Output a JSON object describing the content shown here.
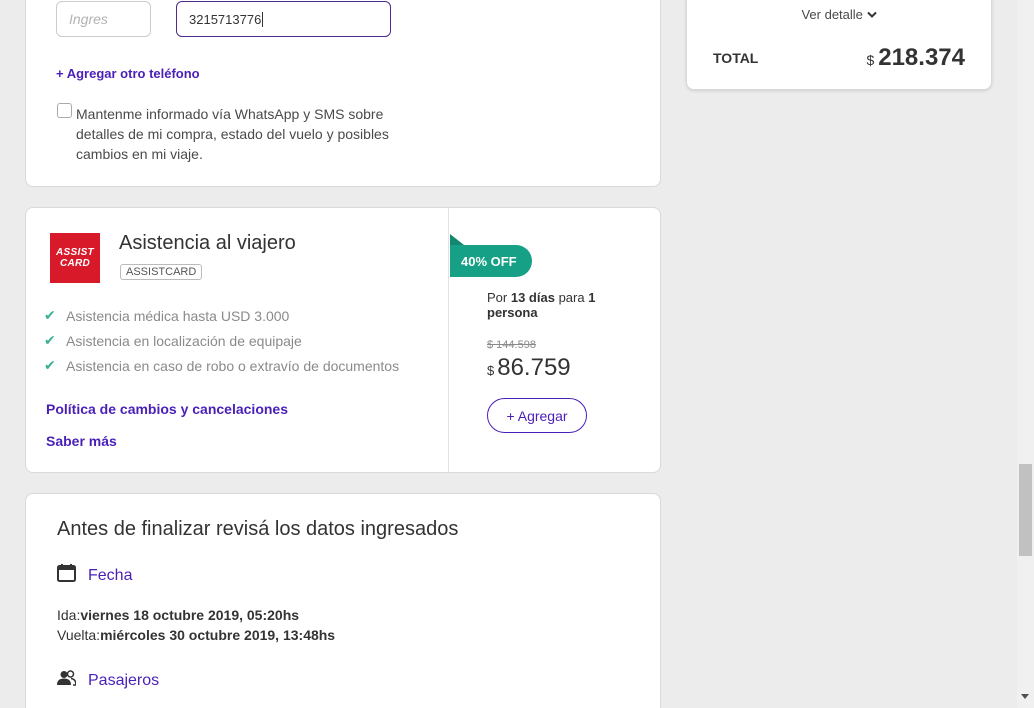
{
  "phone_form": {
    "area_placeholder": "Ingres",
    "phone_value": "3215713776",
    "add_phone_link": "+ Agregar otro teléfono",
    "whatsapp_text": "Mantenme informado vía WhatsApp y SMS sobre detalles de mi compra, estado del vuelo y posibles cambios en mi viaje.",
    "whatsapp_checked": false
  },
  "assistance": {
    "logo_lines": [
      "ASSIST",
      "CARD"
    ],
    "title": "Asistencia al viajero",
    "provider": "ASSISTCARD",
    "features": [
      "Asistencia médica hasta USD 3.000",
      "Asistencia en localización de equipaje",
      "Asistencia en caso de robo o extravío de documentos"
    ],
    "policy_link": "Política de cambios y cancelaciones",
    "more_link": "Saber más",
    "discount": "40% OFF",
    "per_prefix": "Por",
    "days": "13 días",
    "per_middle": "para",
    "persons": "1 persona",
    "old_price": "$ 144.598",
    "currency": "$",
    "new_price": "86.759",
    "add_button": "+ Agregar"
  },
  "review": {
    "title": "Antes de finalizar revisá los datos ingresados",
    "date_section": "Fecha",
    "outbound_label": "Ida:",
    "outbound_value": "viernes 18 octubre 2019, 05:20hs",
    "return_label": "Vuelta:",
    "return_value": "miércoles 30 octubre 2019, 13:48hs",
    "passengers_section": "Pasajeros"
  },
  "summary": {
    "detail_toggle": "Ver detalle",
    "total_label": "TOTAL",
    "currency": "$",
    "total_amount": "218.374"
  },
  "colors": {
    "accent": "#4a1fb8",
    "discount": "#16a085",
    "check": "#3aaf93",
    "assist_red": "#d8192a"
  }
}
